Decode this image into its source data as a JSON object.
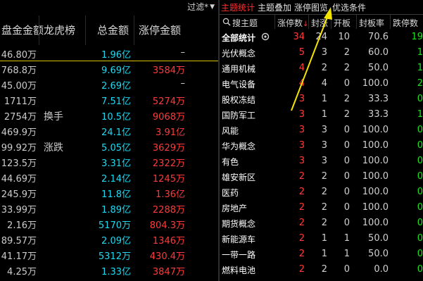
{
  "left_panel": {
    "filter_label": "过滤*",
    "headers": [
      "盘金金额",
      "龙虎榜",
      "总金额",
      "涨停金额"
    ],
    "rows": [
      {
        "c1": "46.80万",
        "c2": "",
        "c3": "1.96亿",
        "c4": "–"
      },
      {
        "c1": "768.8万",
        "c2": "",
        "c3": "9.69亿",
        "c4": "3584万"
      },
      {
        "c1": "45.00万",
        "c2": "",
        "c3": "2.69亿",
        "c4": "–"
      },
      {
        "c1": "1711万",
        "c2": "",
        "c3": "7.51亿",
        "c4": "5274万"
      },
      {
        "c1": "2754万",
        "c2": "换手",
        "c3": "10.5亿",
        "c4": "9068万"
      },
      {
        "c1": "469.9万",
        "c2": "",
        "c3": "24.1亿",
        "c4": "3.91亿"
      },
      {
        "c1": "99.92万",
        "c2": "涨跌",
        "c3": "5.05亿",
        "c4": "3629万"
      },
      {
        "c1": "123.5万",
        "c2": "",
        "c3": "3.31亿",
        "c4": "2322万"
      },
      {
        "c1": "44.69万",
        "c2": "",
        "c3": "2.14亿",
        "c4": "1245万"
      },
      {
        "c1": "245.9万",
        "c2": "",
        "c3": "11.8亿",
        "c4": "1.36亿"
      },
      {
        "c1": "33.99万",
        "c2": "",
        "c3": "1.89亿",
        "c4": "2288万"
      },
      {
        "c1": "2.16万",
        "c2": "",
        "c3": "5170万",
        "c4": "804.3万"
      },
      {
        "c1": "89.57万",
        "c2": "",
        "c3": "2.09亿",
        "c4": "1346万"
      },
      {
        "c1": "41.17万",
        "c2": "",
        "c3": "5312万",
        "c4": "430.4万"
      },
      {
        "c1": "4.25万",
        "c2": "",
        "c3": "1.33亿",
        "c4": "3847万"
      }
    ]
  },
  "right_panel": {
    "tabs": [
      "主题统计",
      "主题叠加",
      "涨停图览",
      "优选条件"
    ],
    "active_tab": 0,
    "headers": [
      "搜主题",
      "涨停数",
      "封涨",
      "开板",
      "封板率",
      "跌停数"
    ],
    "rows": [
      {
        "name": "全部统计",
        "v1": "34",
        "v2": "24",
        "v3": "10",
        "v4": "70.6",
        "v5": "19"
      },
      {
        "name": "光伏概念",
        "v1": "5",
        "v2": "3",
        "v3": "2",
        "v4": "60.0",
        "v5": "1"
      },
      {
        "name": "通用机械",
        "v1": "4",
        "v2": "2",
        "v3": "2",
        "v4": "50.0",
        "v5": "1"
      },
      {
        "name": "电气设备",
        "v1": "4",
        "v2": "4",
        "v3": "0",
        "v4": "100.0",
        "v5": "2"
      },
      {
        "name": "股权冻结",
        "v1": "3",
        "v2": "1",
        "v3": "2",
        "v4": "33.3",
        "v5": "0"
      },
      {
        "name": "国防军工",
        "v1": "3",
        "v2": "1",
        "v3": "2",
        "v4": "33.3",
        "v5": "1"
      },
      {
        "name": "风能",
        "v1": "3",
        "v2": "3",
        "v3": "0",
        "v4": "100.0",
        "v5": "0"
      },
      {
        "name": "华为概念",
        "v1": "3",
        "v2": "3",
        "v3": "0",
        "v4": "100.0",
        "v5": "0"
      },
      {
        "name": "有色",
        "v1": "3",
        "v2": "3",
        "v3": "0",
        "v4": "100.0",
        "v5": "0"
      },
      {
        "name": "雄安新区",
        "v1": "2",
        "v2": "2",
        "v3": "0",
        "v4": "100.0",
        "v5": "0"
      },
      {
        "name": "医药",
        "v1": "2",
        "v2": "2",
        "v3": "0",
        "v4": "100.0",
        "v5": "0"
      },
      {
        "name": "房地产",
        "v1": "2",
        "v2": "2",
        "v3": "0",
        "v4": "100.0",
        "v5": "0"
      },
      {
        "name": "期货概念",
        "v1": "2",
        "v2": "2",
        "v3": "0",
        "v4": "100.0",
        "v5": "0"
      },
      {
        "name": "新能源车",
        "v1": "2",
        "v2": "1",
        "v3": "1",
        "v4": "50.0",
        "v5": "0"
      },
      {
        "name": "一带一路",
        "v1": "2",
        "v2": "1",
        "v3": "1",
        "v4": "50.0",
        "v5": "0"
      },
      {
        "name": "燃料电池",
        "v1": "2",
        "v2": "2",
        "v3": "0",
        "v4": "0.0",
        "v5": "0"
      }
    ]
  },
  "colors": {
    "background": "#000000",
    "up_red": "#ff3a3a",
    "cyan_value": "#20d8f0",
    "down_green": "#20e020",
    "active_tab": "#ff3030",
    "highlight_line": "#d6c200",
    "annotation_arrow": "#f5e400"
  },
  "icons": [
    "search-icon",
    "gear-icon",
    "sort-indicator-icon",
    "dropdown-arrow-icon",
    "annotation-arrow-icon"
  ]
}
